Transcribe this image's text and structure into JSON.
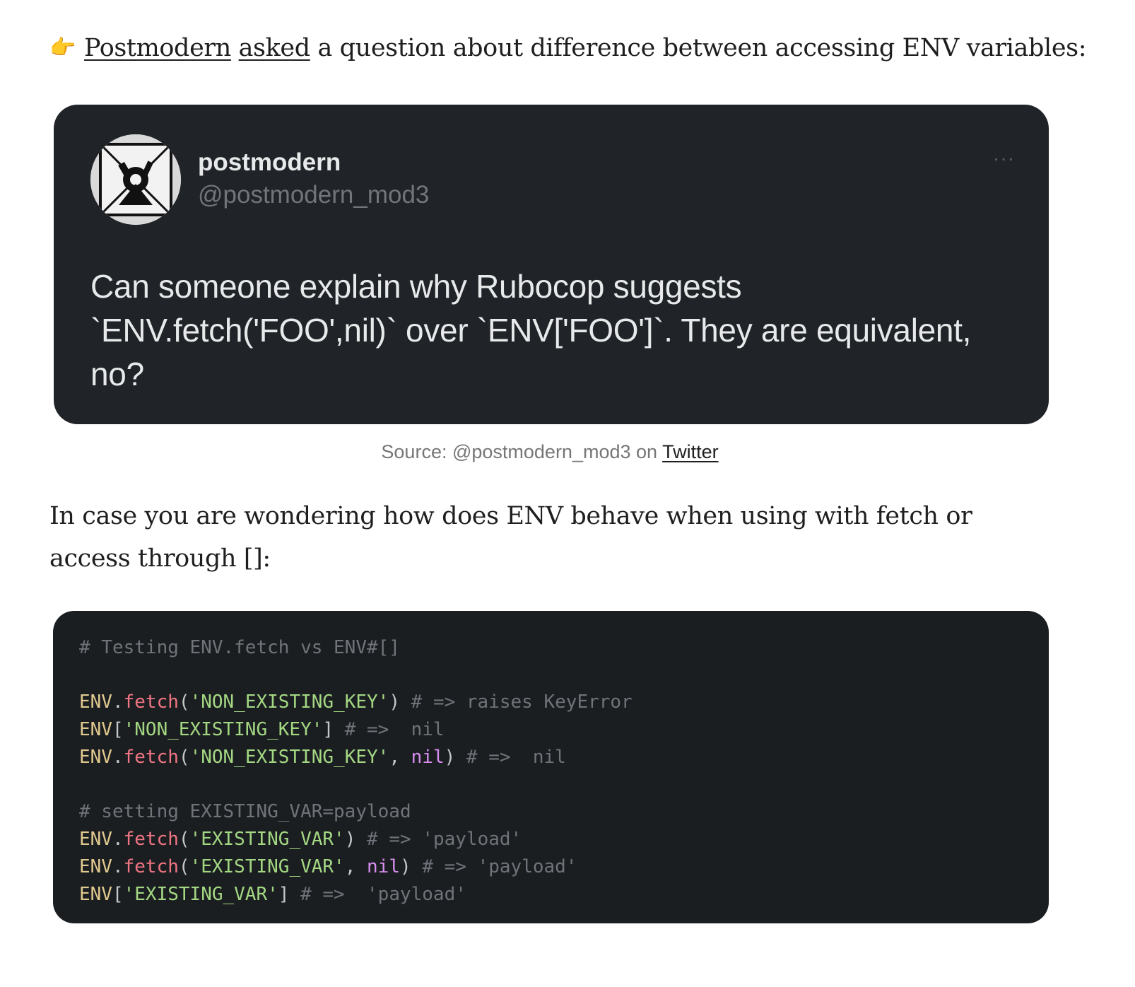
{
  "intro": {
    "pointer_icon": "👉",
    "link_postmodern": "Postmodern",
    "link_asked": "asked",
    "rest": "a question about difference between accessing ENV variables:"
  },
  "tweet": {
    "author_name": "postmodern",
    "author_handle": "@postmodern_mod3",
    "more_icon": "···",
    "text_line1": "Can someone explain why Rubocop suggests",
    "text_line2": "`ENV.fetch('FOO',nil)` over `ENV['FOO']`. They are equivalent,",
    "text_line3": "no?"
  },
  "caption": {
    "prefix": "Source: @postmodern_mod3 on",
    "link": "Twitter"
  },
  "paragraph": "In case you are wondering how does ENV behave when using with fetch or access through []:",
  "code": {
    "lines": [
      [
        {
          "t": "comment",
          "v": "# Testing ENV.fetch vs ENV#[]"
        }
      ],
      [],
      [
        {
          "t": "const",
          "v": "ENV"
        },
        {
          "t": "punct",
          "v": "."
        },
        {
          "t": "method",
          "v": "fetch"
        },
        {
          "t": "punct",
          "v": "("
        },
        {
          "t": "string",
          "v": "'NON_EXISTING_KEY'"
        },
        {
          "t": "punct",
          "v": ") "
        },
        {
          "t": "comment",
          "v": "# => raises KeyError"
        }
      ],
      [
        {
          "t": "const",
          "v": "ENV"
        },
        {
          "t": "punct",
          "v": "["
        },
        {
          "t": "string",
          "v": "'NON_EXISTING_KEY'"
        },
        {
          "t": "punct",
          "v": "] "
        },
        {
          "t": "comment",
          "v": "# =>  nil"
        }
      ],
      [
        {
          "t": "const",
          "v": "ENV"
        },
        {
          "t": "punct",
          "v": "."
        },
        {
          "t": "method",
          "v": "fetch"
        },
        {
          "t": "punct",
          "v": "("
        },
        {
          "t": "string",
          "v": "'NON_EXISTING_KEY'"
        },
        {
          "t": "punct",
          "v": ", "
        },
        {
          "t": "kw",
          "v": "nil"
        },
        {
          "t": "punct",
          "v": ") "
        },
        {
          "t": "comment",
          "v": "# =>  nil"
        }
      ],
      [],
      [
        {
          "t": "comment",
          "v": "# setting EXISTING_VAR=payload"
        }
      ],
      [
        {
          "t": "const",
          "v": "ENV"
        },
        {
          "t": "punct",
          "v": "."
        },
        {
          "t": "method",
          "v": "fetch"
        },
        {
          "t": "punct",
          "v": "("
        },
        {
          "t": "string",
          "v": "'EXISTING_VAR'"
        },
        {
          "t": "punct",
          "v": ") "
        },
        {
          "t": "comment",
          "v": "# => 'payload'"
        }
      ],
      [
        {
          "t": "const",
          "v": "ENV"
        },
        {
          "t": "punct",
          "v": "."
        },
        {
          "t": "method",
          "v": "fetch"
        },
        {
          "t": "punct",
          "v": "("
        },
        {
          "t": "string",
          "v": "'EXISTING_VAR'"
        },
        {
          "t": "punct",
          "v": ", "
        },
        {
          "t": "kw",
          "v": "nil"
        },
        {
          "t": "punct",
          "v": ") "
        },
        {
          "t": "comment",
          "v": "# => 'payload'"
        }
      ],
      [
        {
          "t": "const",
          "v": "ENV"
        },
        {
          "t": "punct",
          "v": "["
        },
        {
          "t": "string",
          "v": "'EXISTING_VAR'"
        },
        {
          "t": "punct",
          "v": "] "
        },
        {
          "t": "comment",
          "v": "# =>  'payload'"
        }
      ]
    ]
  },
  "colors": {
    "tweet_bg": "#202327",
    "code_bg": "#1b1e21",
    "string": "#a3d782",
    "method": "#f07583",
    "const": "#e0c98f",
    "keyword": "#d78ef0",
    "comment": "#6f747a"
  }
}
